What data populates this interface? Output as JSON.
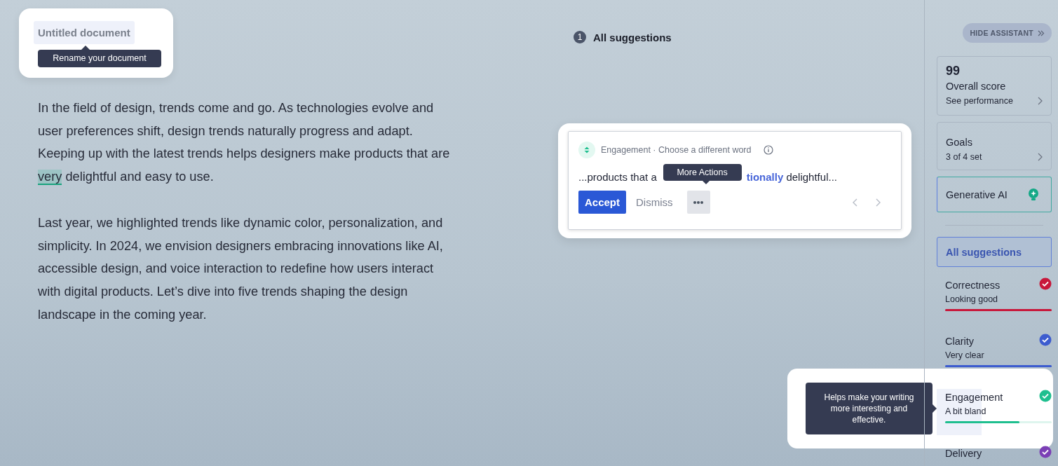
{
  "document": {
    "title": "Untitled document",
    "title_tooltip": "Rename your document",
    "paragraphs": [
      {
        "segments": [
          {
            "text": "In the field of design, trends come and go. As technologies evolve and user preferences shift, design trends naturally progress and adapt. Keeping up with the latest trends helps designers make products that are ",
            "flagged": false
          },
          {
            "text": "very",
            "flagged": true
          },
          {
            "text": " delightful and easy to use.",
            "flagged": false
          }
        ]
      },
      {
        "segments": [
          {
            "text": "Last year, we highlighted trends like dynamic color, personalization, and simplicity. In 2024, we envision designers embracing innovations like AI, accessible design, and voice interaction to redefine how users interact with digital products. Let’s dive into five trends shaping the design landscape in the coming year.",
            "flagged": false
          }
        ]
      }
    ]
  },
  "suggestions": {
    "count": "1",
    "label": "All suggestions",
    "card": {
      "category": "Engagement · Choose a different word",
      "snippet_start": "...products that a",
      "snippet_end": "**tionally** delightful...",
      "accept": "Accept",
      "dismiss": "Dismiss",
      "more_tooltip": "More Actions"
    }
  },
  "sidebar": {
    "hide_button": "HIDE ASSISTANT",
    "score": {
      "value": "99",
      "label": "Overall score",
      "link": "See performance"
    },
    "goals": {
      "label": "Goals",
      "status": "3 of 4 set"
    },
    "generative": {
      "label": "Generative AI"
    },
    "all_suggestions": {
      "label": "All suggestions",
      "selected": true
    },
    "categories": [
      {
        "name": "Correctness",
        "status": "Looking good",
        "level": 1,
        "color": "#c8173a",
        "highlighted": false
      },
      {
        "name": "Clarity",
        "status": "Very clear",
        "level": 1,
        "color": "#3d5ccf",
        "highlighted": false
      },
      {
        "name": "Engagement",
        "status": "A bit bland",
        "level": 0.7,
        "color": "#1fbf8f",
        "highlighted": true,
        "tooltip": "Helps make your writing more interesting and effective."
      },
      {
        "name": "Delivery",
        "color": "#7b3fb5",
        "highlighted": false
      }
    ]
  }
}
